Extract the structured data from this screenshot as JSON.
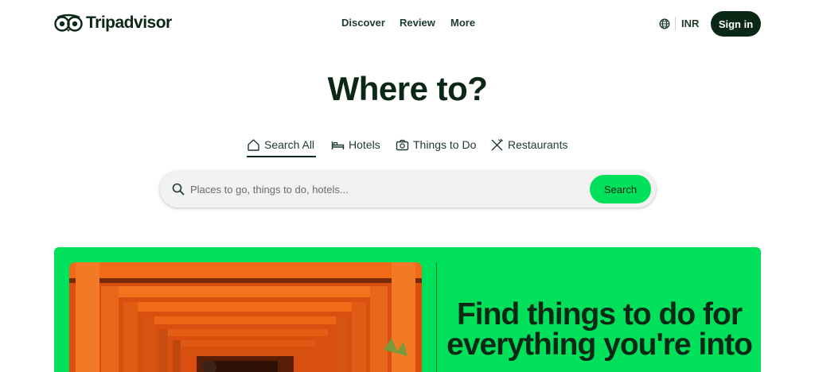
{
  "header": {
    "brand": "Tripadvisor",
    "nav": [
      {
        "label": "Discover"
      },
      {
        "label": "Review"
      },
      {
        "label": "More"
      }
    ],
    "currency": "INR",
    "signin_label": "Sign in"
  },
  "hero": {
    "title": "Where to?"
  },
  "tabs": [
    {
      "label": "Search All",
      "icon": "home-icon",
      "active": true
    },
    {
      "label": "Hotels",
      "icon": "bed-icon",
      "active": false
    },
    {
      "label": "Things to Do",
      "icon": "camera-icon",
      "active": false
    },
    {
      "label": "Restaurants",
      "icon": "utensils-icon",
      "active": false
    }
  ],
  "search": {
    "placeholder": "Places to go, things to do, hotels...",
    "value": "",
    "button_label": "Search"
  },
  "promo": {
    "heading": "Find things to do for everything you're into",
    "image": "torii-gates-photo"
  },
  "colors": {
    "brand_dark": "#0b2716",
    "accent_green": "#00e05a",
    "search_bg": "#f2f2f2"
  }
}
